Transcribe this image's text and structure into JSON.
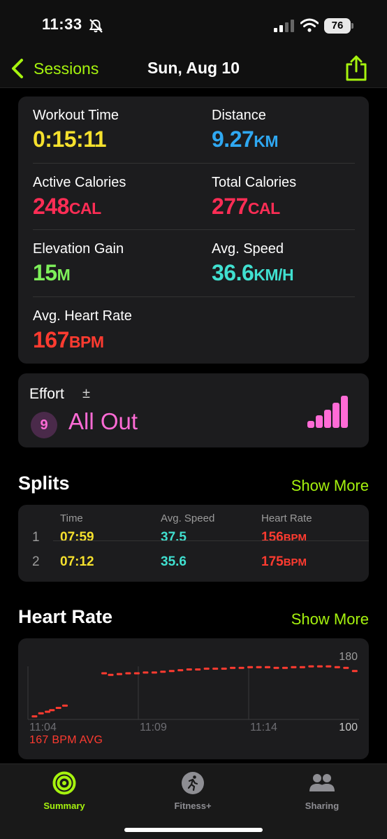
{
  "status_bar": {
    "time": "11:33",
    "battery": "76"
  },
  "nav": {
    "back_label": "Sessions",
    "title": "Sun, Aug 10"
  },
  "metrics": [
    {
      "label": "Workout Time",
      "value": "0:15:11",
      "unit": "",
      "color": "#f5e02d"
    },
    {
      "label": "Distance",
      "value": "9.27",
      "unit": "KM",
      "color": "#2fa8f2"
    },
    {
      "label": "Active Calories",
      "value": "248",
      "unit": "CAL",
      "color": "#ff2d55"
    },
    {
      "label": "Total Calories",
      "value": "277",
      "unit": "CAL",
      "color": "#ff2d55"
    },
    {
      "label": "Elevation Gain",
      "value": "15",
      "unit": "M",
      "color": "#7ef05a"
    },
    {
      "label": "Avg. Speed",
      "value": "36.6",
      "unit": "KM/H",
      "color": "#40e0d0"
    },
    {
      "label": "Avg. Heart Rate",
      "value": "167",
      "unit": "BPM",
      "color": "#ff3b30"
    }
  ],
  "effort": {
    "label": "Effort",
    "adjust_symbol": "±",
    "score": "9",
    "text": "All Out",
    "color": "#ff6bd6"
  },
  "splits": {
    "title": "Splits",
    "show_more": "Show More",
    "headers": [
      "Time",
      "Avg. Speed",
      "Heart Rate"
    ],
    "rows": [
      {
        "index": "1",
        "time": "07:59",
        "speed": "37.5",
        "hr": "156",
        "hr_unit": "BPM"
      },
      {
        "index": "2",
        "time": "07:12",
        "speed": "35.6",
        "hr": "175",
        "hr_unit": "BPM"
      }
    ]
  },
  "heart_rate": {
    "title": "Heart Rate",
    "show_more": "Show More",
    "avg_label": "167 BPM AVG",
    "y_max_label": "180",
    "y_min_label": "100",
    "x_labels": [
      "11:04",
      "11:09",
      "11:14"
    ]
  },
  "chart_data": {
    "type": "scatter",
    "title": "",
    "xlabel": "",
    "ylabel": "",
    "x_ticks": [
      "11:04",
      "11:09",
      "11:14"
    ],
    "xlim_minutes": [
      0,
      15.2
    ],
    "ylim": [
      100,
      180
    ],
    "series": [
      {
        "color": "#ff3b30",
        "x": [
          0.3,
          0.6,
          0.9,
          1.1,
          1.4,
          1.7,
          3.5,
          3.8,
          4.2,
          4.6,
          5.0,
          5.4,
          5.8,
          6.2,
          6.6,
          7.0,
          7.4,
          7.8,
          8.2,
          8.6,
          9.0,
          9.4,
          9.8,
          10.2,
          10.6,
          11.0,
          11.4,
          11.8,
          12.2,
          12.6,
          13.0,
          13.4,
          13.8,
          14.2,
          14.6,
          15.0
        ],
        "y": [
          104,
          108,
          110,
          112,
          115,
          118,
          160,
          158,
          159,
          160,
          160,
          161,
          161,
          162,
          163,
          164,
          165,
          165,
          166,
          166,
          166,
          167,
          167,
          168,
          168,
          168,
          167,
          167,
          168,
          168,
          169,
          169,
          169,
          168,
          167,
          163
        ]
      }
    ]
  },
  "tabs": [
    {
      "label": "Summary",
      "icon": "activity-rings-icon",
      "active": true
    },
    {
      "label": "Fitness+",
      "icon": "runner-icon",
      "active": false
    },
    {
      "label": "Sharing",
      "icon": "people-icon",
      "active": false
    }
  ],
  "colors": {
    "accent": "#a6f30e",
    "card": "#1c1c1e"
  }
}
